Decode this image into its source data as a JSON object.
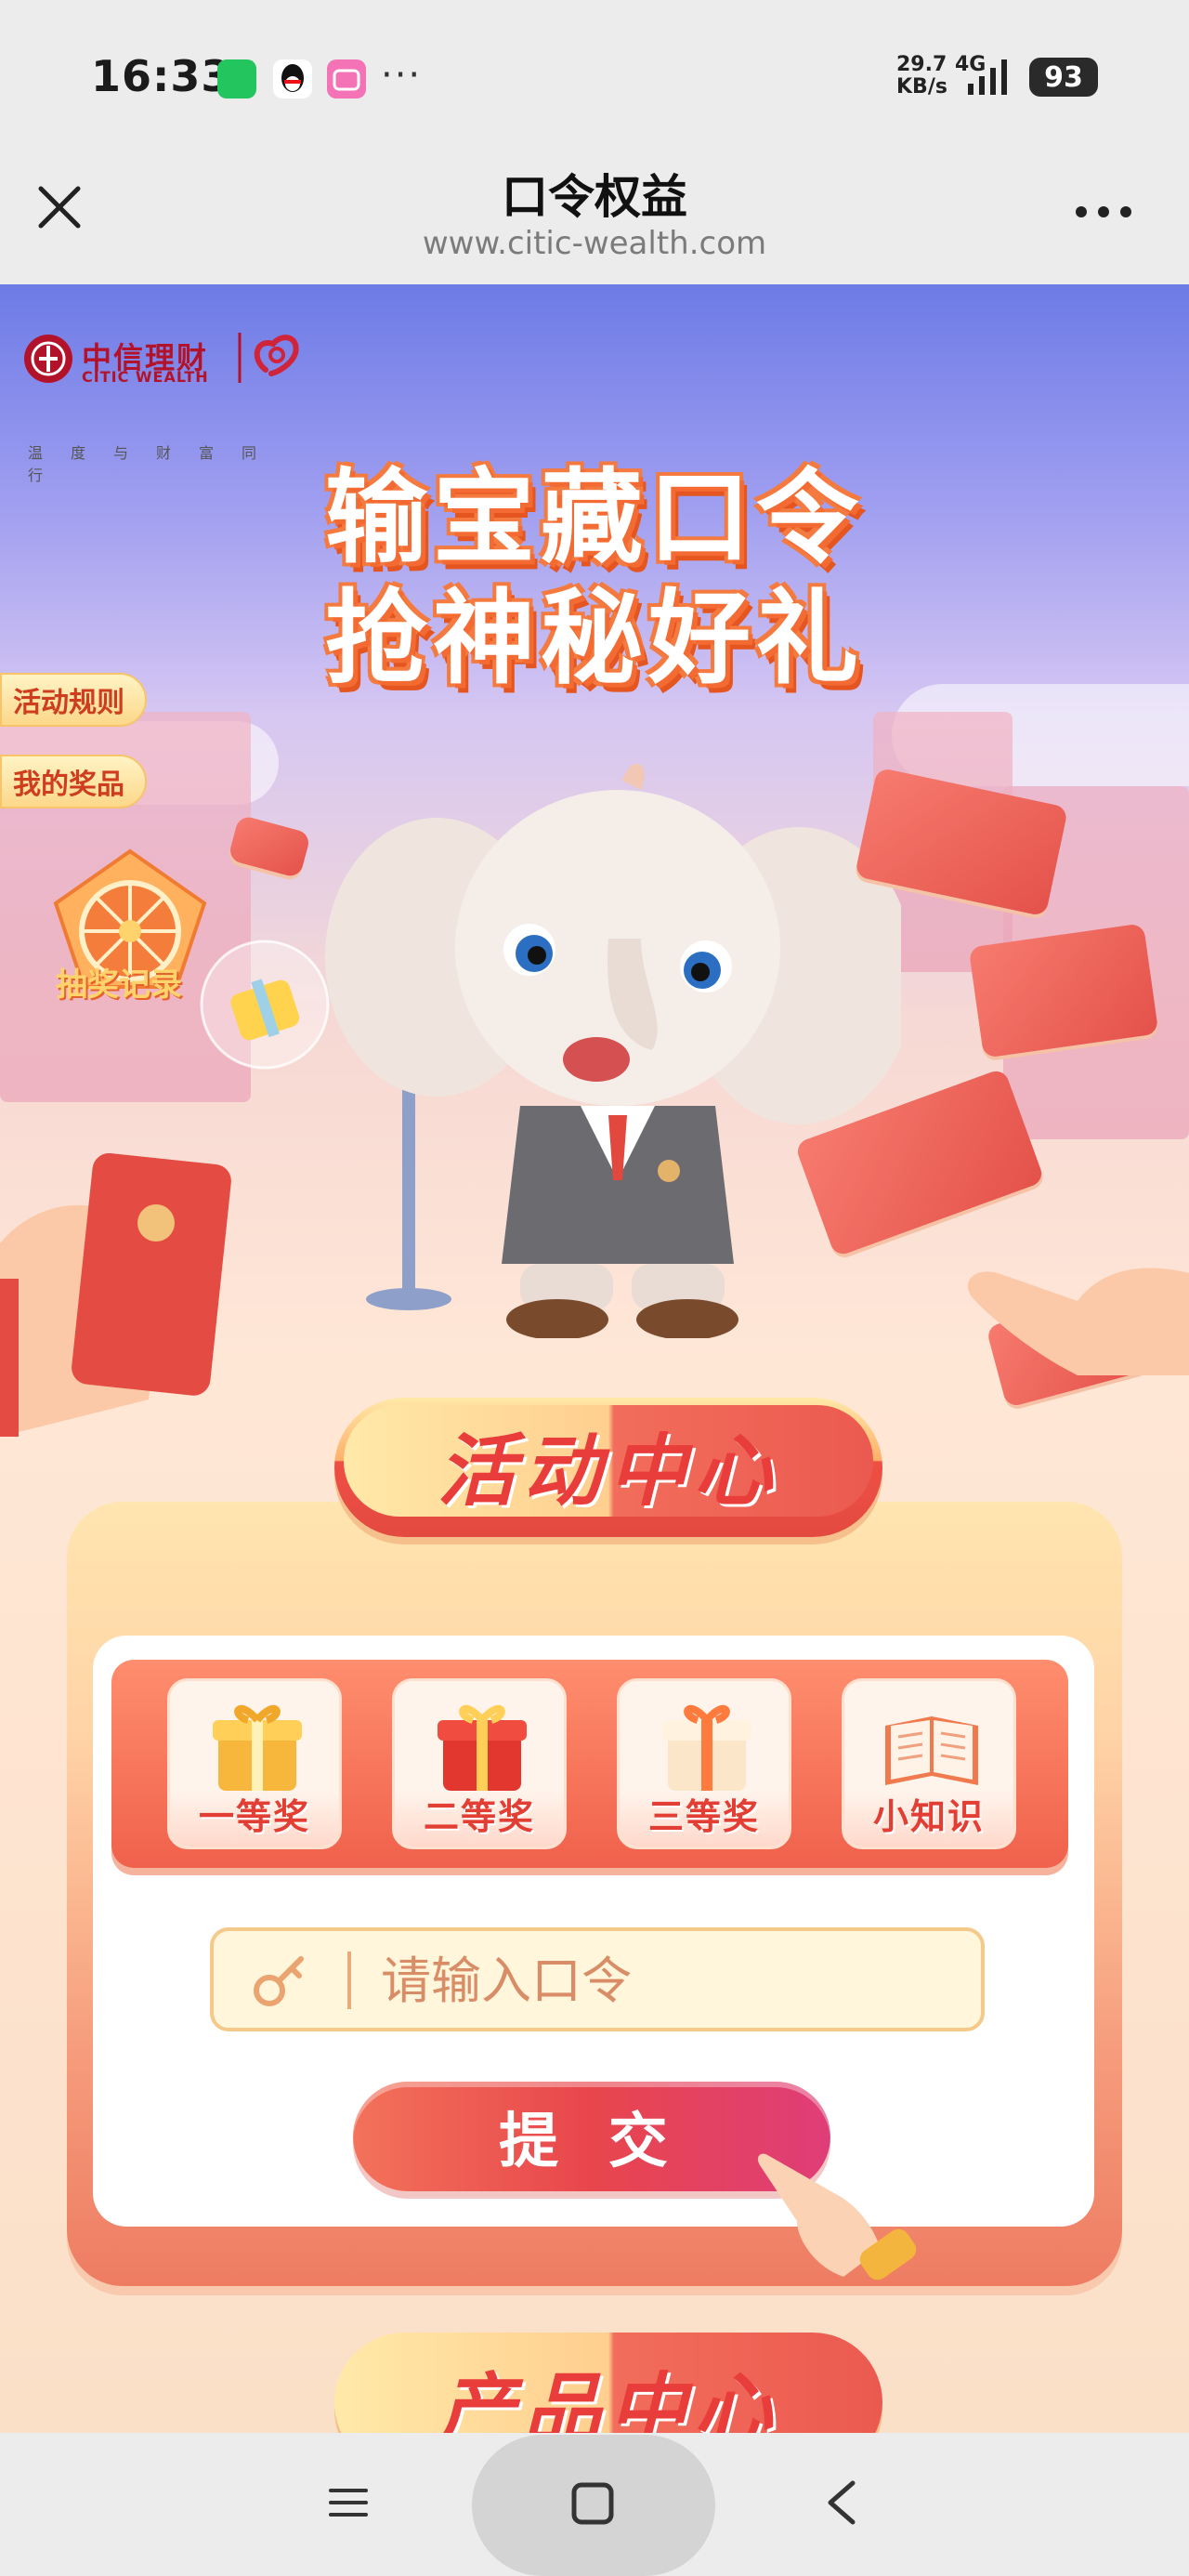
{
  "status_bar": {
    "time": "16:33",
    "net_speed_value": "29.7",
    "net_speed_unit": "KB/s",
    "network_type": "4G",
    "battery": "93",
    "more": "···"
  },
  "nav": {
    "title": "口令权益",
    "url": "www.citic-wealth.com"
  },
  "brand": {
    "name_cn": "中信理财",
    "name_en": "CITIC WEALTH",
    "slogan": "温度与财富同行"
  },
  "hero": {
    "headline_line1": "输宝藏口令",
    "headline_line2": "抢神秘好礼"
  },
  "side_tabs": {
    "rules": "活动规则",
    "my_prizes": "我的奖品",
    "draw_record": "抽奖记录"
  },
  "activity": {
    "title": "活动中心",
    "prizes": [
      {
        "label": "一等奖",
        "icon": "gold-gift-icon"
      },
      {
        "label": "二等奖",
        "icon": "red-gift-icon"
      },
      {
        "label": "三等奖",
        "icon": "white-gift-icon"
      },
      {
        "label": "小知识",
        "icon": "book-icon"
      }
    ],
    "input_placeholder": "请输入口令",
    "submit_label": "提 交"
  },
  "product": {
    "title": "产品中心"
  },
  "colors": {
    "accent": "#E83D3A",
    "gold": "#FFD36B",
    "sky": "#6D7BE6"
  }
}
